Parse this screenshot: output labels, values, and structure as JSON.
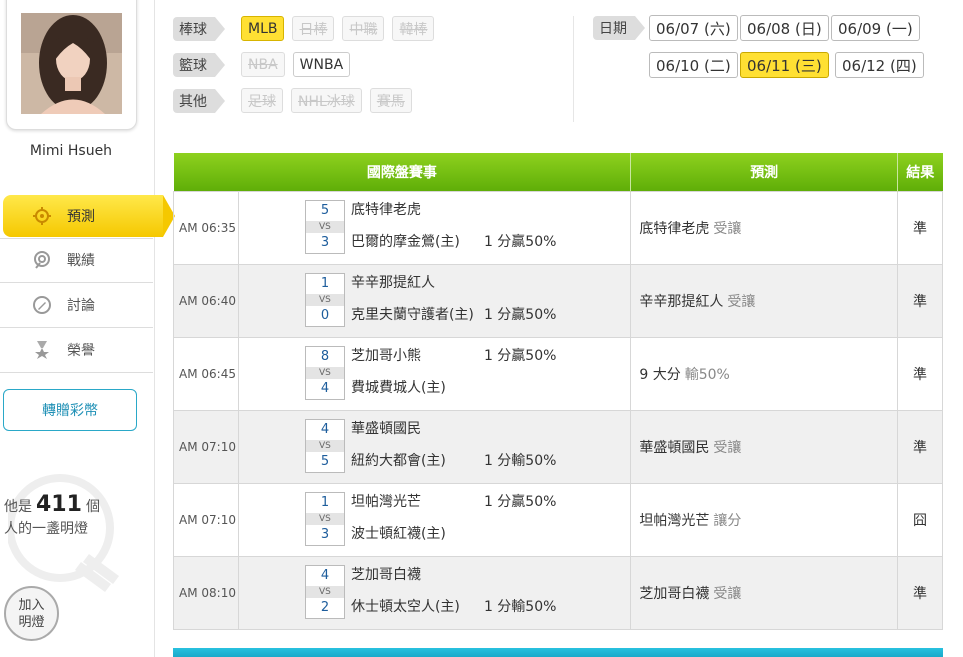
{
  "user": {
    "name": "Mimi Hsueh"
  },
  "sidebar": {
    "items": [
      {
        "label": "預測",
        "icon": "target-icon",
        "active": true
      },
      {
        "label": "戰績",
        "icon": "record-icon",
        "active": false
      },
      {
        "label": "討論",
        "icon": "discuss-icon",
        "active": false
      },
      {
        "label": "榮譽",
        "icon": "medal-icon",
        "active": false
      }
    ],
    "gift_label": "轉贈彩幣",
    "lamp_prefix": "他是",
    "lamp_count": "411",
    "lamp_suffix": "個",
    "lamp_line2": "人的一盞明燈",
    "join_label_1": "加入",
    "join_label_2": "明燈"
  },
  "filters": {
    "baseball": {
      "label": "棒球",
      "chips": [
        "MLB",
        "日棒",
        "中職",
        "韓棒"
      ]
    },
    "basketball": {
      "label": "籃球",
      "chips": [
        "NBA",
        "WNBA"
      ]
    },
    "other": {
      "label": "其他",
      "chips": [
        "足球",
        "NHL冰球",
        "賽馬"
      ]
    },
    "date_label": "日期",
    "dates": [
      "06/07 (六)",
      "06/08 (日)",
      "06/09 (一)",
      "06/10 (二)",
      "06/11 (三)",
      "06/12 (四)"
    ],
    "active_date": "06/11 (三)"
  },
  "table": {
    "headers": {
      "event": "國際盤賽事",
      "prediction": "預測",
      "result": "結果"
    },
    "rows": [
      {
        "time": "AM 06:35",
        "score1": "5",
        "vs": "VS",
        "score2": "3",
        "team1": "底特律老虎",
        "team2": "巴爾的摩金鶯(主)",
        "hcp1": "",
        "hcp2": "1 分贏50%",
        "pred_team": "底特律老虎",
        "pred_tag": "受讓",
        "result": "準"
      },
      {
        "time": "AM 06:40",
        "score1": "1",
        "vs": "VS",
        "score2": "0",
        "team1": "辛辛那提紅人",
        "team2": "克里夫蘭守護者(主)",
        "hcp1": "",
        "hcp2": "1 分贏50%",
        "pred_team": "辛辛那提紅人",
        "pred_tag": "受讓",
        "result": "準"
      },
      {
        "time": "AM 06:45",
        "score1": "8",
        "vs": "VS",
        "score2": "4",
        "team1": "芝加哥小熊",
        "team2": "費城費城人(主)",
        "hcp1": "1 分贏50%",
        "hcp2": "",
        "pred_team": "9 大分",
        "pred_tag": "輸50%",
        "result": "準"
      },
      {
        "time": "AM 07:10",
        "score1": "4",
        "vs": "VS",
        "score2": "5",
        "team1": "華盛頓國民",
        "team2": "紐約大都會(主)",
        "hcp1": "",
        "hcp2": "1 分輸50%",
        "pred_team": "華盛頓國民",
        "pred_tag": "受讓",
        "result": "準"
      },
      {
        "time": "AM 07:10",
        "score1": "1",
        "vs": "VS",
        "score2": "3",
        "team1": "坦帕灣光芒",
        "team2": "波士頓紅襪(主)",
        "hcp1": "1 分贏50%",
        "hcp2": "",
        "pred_team": "坦帕灣光芒",
        "pred_tag": "讓分",
        "result": "囧"
      },
      {
        "time": "AM 08:10",
        "score1": "4",
        "vs": "VS",
        "score2": "2",
        "team1": "芝加哥白襪",
        "team2": "休士頓太空人(主)",
        "hcp1": "",
        "hcp2": "1 分輸50%",
        "pred_team": "芝加哥白襪",
        "pred_tag": "受讓",
        "result": "準"
      }
    ]
  },
  "colors": {
    "accent_yellow": "#ffe033",
    "header_green": "#6dbb10",
    "win_green": "#1a8a2a",
    "footer_cyan": "#1fb2d2"
  }
}
